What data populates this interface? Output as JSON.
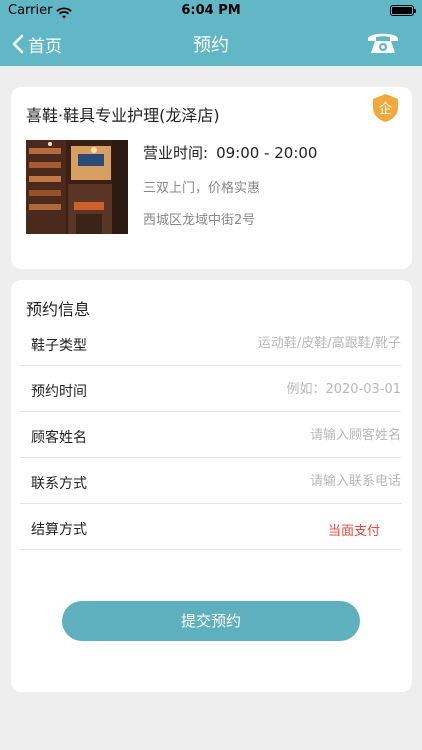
{
  "status_bar": {
    "carrier": "Carrier",
    "time": "6:04 PM"
  },
  "nav": {
    "back_label": "首页",
    "title": "预约"
  },
  "shop": {
    "name": "喜鞋·鞋具专业护理(龙泽店)",
    "badge": "企",
    "hours_label": "营业时间:",
    "hours_value": "09:00 - 20:00",
    "description": "三双上门，价格实惠",
    "address": "西城区龙域中街2号"
  },
  "form": {
    "title": "预约信息",
    "fields": [
      {
        "label": "鞋子类型",
        "placeholder": "运动鞋/皮鞋/高跟鞋/靴子"
      },
      {
        "label": "预约时间",
        "placeholder": "例如：2020-03-01"
      },
      {
        "label": "顾客姓名",
        "placeholder": "请输入顾客姓名"
      },
      {
        "label": "联系方式",
        "placeholder": "请输入联系电话"
      },
      {
        "label": "结算方式",
        "value": "当面支付"
      }
    ],
    "submit_label": "提交预约"
  },
  "colors": {
    "header": "#62b7c7",
    "accent": "#5eb0bf",
    "pay_text": "#e84a3c",
    "badge": "#f2a93b"
  }
}
